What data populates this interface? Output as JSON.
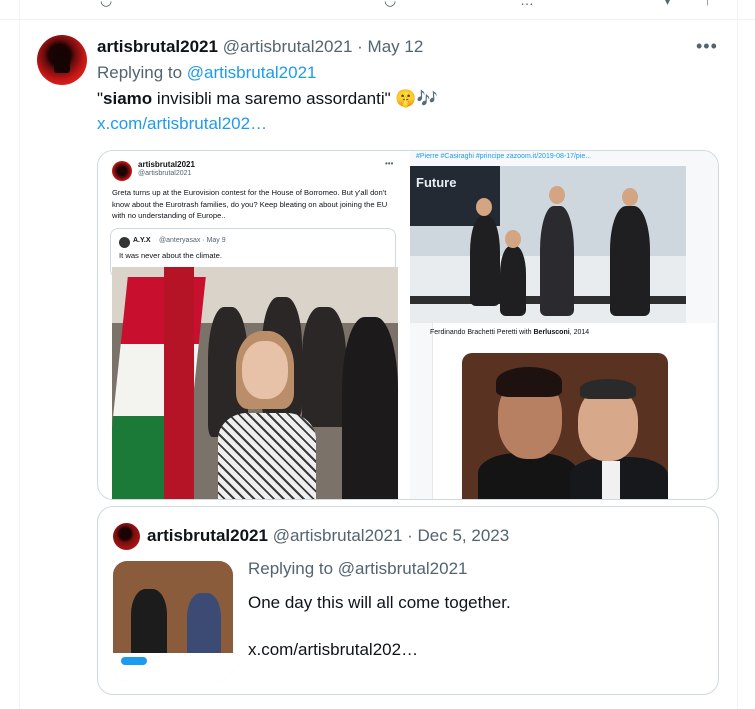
{
  "post": {
    "display_name": "artisbrutal2021",
    "handle": "@artisbrutal2021",
    "date": "May 12",
    "replying_prefix": "Replying to ",
    "replying_to": "@artisbrutal2021",
    "text_open": "\"",
    "text_bold": "siamo",
    "text_rest": " invisibli ma saremo assordanti\" 🤫🎶",
    "link": "x.com/artisbrutal202…",
    "more_icon": "more-horizontal-icon"
  },
  "media": {
    "left_shot": {
      "name": "artisbrutal2021",
      "handle": "@artisbrutal2021",
      "text": "Greta turns up at the Eurovision contest for the House of Borromeo. But y'all don't know about the Eurotrash families, do you? Keep bleating on about joining the EU with no understanding of Europe..",
      "quote_name": "A.Y.X",
      "quote_handle": "@anteryasax · May 9",
      "quote_text": "It was never about the climate."
    },
    "right_shot": {
      "url_caption": "#Pierre #Casiraghi #principe zazoom.it/2019-08-17/pie...",
      "boat_text": "Future",
      "lower_caption_pre": "Ferdinando Brachetti Peretti with ",
      "lower_caption_bold": "Berlusconi",
      "lower_caption_post": ", 2014"
    }
  },
  "quoted": {
    "display_name": "artisbrutal2021",
    "handle_date": "@artisbrutal2021 · Dec 5, 2023",
    "replying_line": "Replying to @artisbrutal2021",
    "text": "One day this will all come together.",
    "link": "x.com/artisbrutal202…"
  }
}
